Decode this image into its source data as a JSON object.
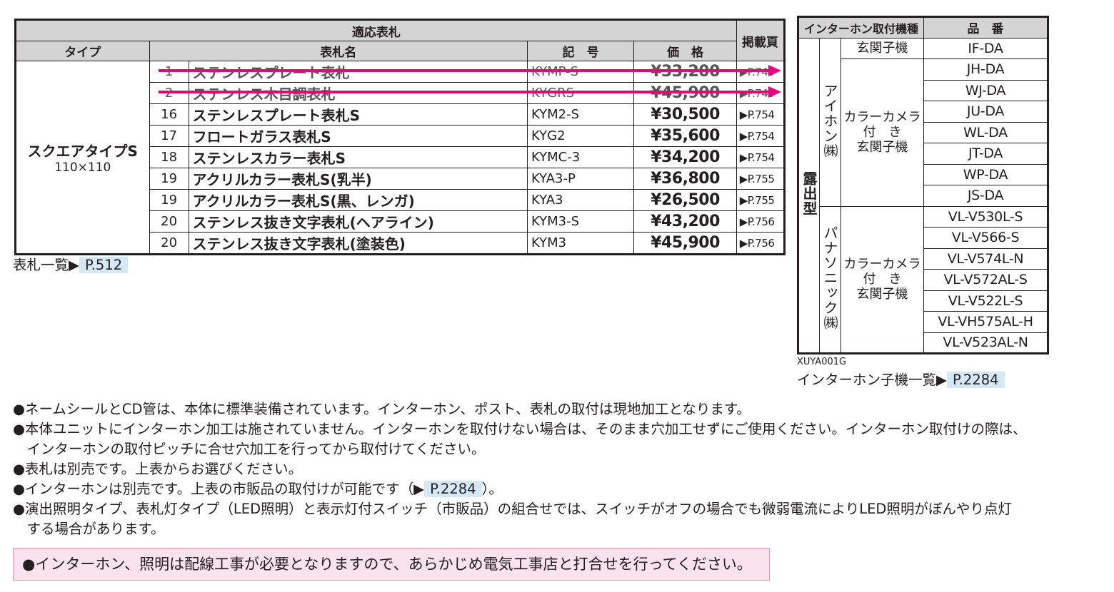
{
  "plate_table": {
    "header_group": "適応表札",
    "col_type": "タイプ",
    "col_name": "表札名",
    "col_code": "記　号",
    "col_price": "価　格",
    "col_page": "掲載頁",
    "type_name": "スクエアタイプS",
    "type_size": "110×110",
    "rows": [
      {
        "no": "1",
        "name": "ステンレスプレート表札",
        "code": "KYMP-S",
        "price": "¥33,200",
        "page": "▶P.749",
        "discontinued": true
      },
      {
        "no": "2",
        "name": "ステンレス木目調表札",
        "code": "KYGRS",
        "price": "¥45,900",
        "page": "▶P.749",
        "discontinued": true
      },
      {
        "no": "16",
        "name": "ステンレスプレート表札S",
        "code": "KYM2-S",
        "price": "¥30,500",
        "page": "▶P.754"
      },
      {
        "no": "17",
        "name": "フロートガラス表札S",
        "code": "KYG2",
        "price": "¥35,600",
        "page": "▶P.754"
      },
      {
        "no": "18",
        "name": "ステンレスカラー表札S",
        "code": "KYMC-3",
        "price": "¥34,200",
        "page": "▶P.754"
      },
      {
        "no": "19",
        "name": "アクリルカラー表札S(乳半)",
        "code": "KYA3-P",
        "price": "¥36,800",
        "page": "▶P.755"
      },
      {
        "no": "19",
        "name": "アクリルカラー表札S(黒、レンガ)",
        "code": "KYA3",
        "price": "¥26,500",
        "page": "▶P.755"
      },
      {
        "no": "20",
        "name": "ステンレス抜き文字表札(ヘアライン)",
        "code": "KYM3-S",
        "price": "¥43,200",
        "page": "▶P.756"
      },
      {
        "no": "20",
        "name": "ステンレス抜き文字表札(塗装色)",
        "code": "KYM3",
        "price": "¥45,900",
        "page": "▶P.756"
      }
    ],
    "link_text": "表札一覧▶",
    "link_page": "P.512"
  },
  "intercom_table": {
    "col_type": "インターホン取付機種",
    "col_part": "品　番",
    "mount": "露出型",
    "makers": [
      {
        "name": "アイホン㈱",
        "groups": [
          {
            "unit": [
              "玄関子機"
            ],
            "parts": [
              "IF-DA"
            ]
          },
          {
            "unit": [
              "カラーカメラ",
              "付　き",
              "玄関子機"
            ],
            "parts": [
              "JH-DA",
              "WJ-DA",
              "JU-DA",
              "WL-DA",
              "JT-DA",
              "WP-DA",
              "JS-DA"
            ]
          }
        ]
      },
      {
        "name": "パナソニック㈱",
        "groups": [
          {
            "unit": [
              "カラーカメラ",
              "付　き",
              "玄関子機"
            ],
            "parts": [
              "VL-V530L-S",
              "VL-V566-S",
              "VL-V574L-N",
              "VL-V572AL-S",
              "VL-V522L-S",
              "VL-VH575AL-H",
              "VL-V523AL-N"
            ]
          }
        ]
      }
    ],
    "code": "XUYA001G",
    "link_text": "インターホン子機一覧▶",
    "link_page": "P.2284"
  },
  "notes": [
    "●ネームシールとCD管は、本体に標準装備されています。インターホン、ポスト、表札の取付は現地加工となります。",
    "●本体ユニットにインターホン加工は施されていません。インターホンを取付けない場合は、そのまま穴加工せずにご使用ください。インターホン取付けの際は、",
    "　インターホンの取付ピッチに合せ穴加工を行ってから取付けてください。",
    "●表札は別売です。上表からお選びください。",
    "●演出照明タイプ、表札灯タイプ（LED照明）と表示灯付スイッチ（市販品）の組合せでは、スイッチがオフの場合でも微弱電流によりLED照明がぼんやり点灯",
    "　する場合があります。"
  ],
  "note_intercom": {
    "before": "●インターホンは別売です。上表の市販品の取付けが可能です（▶",
    "page": "P.2284",
    "after": "）。"
  },
  "notice": "●インターホン、照明は配線工事が必要となりますので、あらかじめ電気工事店と打合せを行ってください。",
  "colors": {
    "header_bg": "#d4d4d4",
    "strike": "#e5007e",
    "link_bg": "#d5e8f5",
    "notice_bg": "#fbe3ee"
  }
}
